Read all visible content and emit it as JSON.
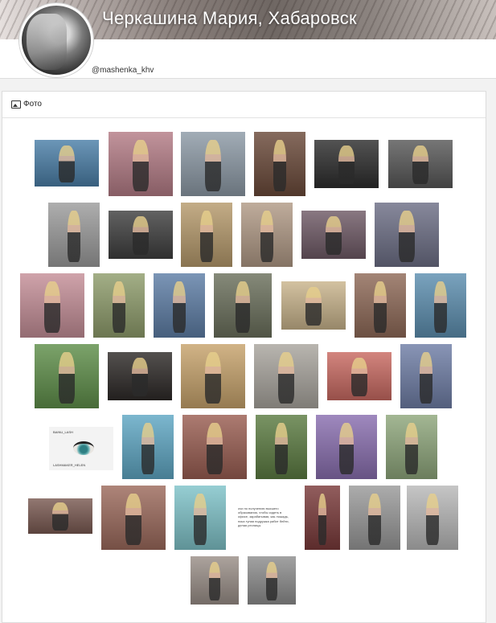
{
  "header": {
    "title": "Черкашина Мария, Хабаровск",
    "username": "@mashenka_khv"
  },
  "photos_section": {
    "label": "Фото",
    "icon": "image-icon"
  },
  "text_card": {
    "text": "очи по получению высшего образования, чтобы сидеть в офисе, зарабатывая, как лошадь, пока тупая подружка рабит бейти, делая ресницы"
  },
  "lash_card": {
    "top_text": "BAINU_LASH",
    "bottom_text": "LASHMAKER_HELEN"
  },
  "photos": [
    {
      "name": "photo-1",
      "color": "#4b7fa8"
    },
    {
      "name": "photo-2",
      "color": "#b47c86"
    },
    {
      "name": "photo-3",
      "color": "#8d9aa6"
    },
    {
      "name": "photo-4",
      "color": "#6b4a3a"
    },
    {
      "name": "photo-5",
      "color": "#2d2d2d"
    },
    {
      "name": "photo-6",
      "color": "#585858"
    },
    {
      "name": "photo-7",
      "color": "#9c9c9c"
    },
    {
      "name": "photo-8",
      "color": "#3f3f3f"
    },
    {
      "name": "photo-9",
      "color": "#b69a6c"
    },
    {
      "name": "photo-10",
      "color": "#b19a86"
    },
    {
      "name": "photo-11",
      "color": "#6f5a66"
    },
    {
      "name": "photo-12",
      "color": "#6d6f86"
    },
    {
      "name": "photo-13",
      "color": "#c58f98"
    },
    {
      "name": "photo-14",
      "color": "#8f9d6c"
    },
    {
      "name": "photo-15",
      "color": "#5e7ea6"
    },
    {
      "name": "photo-16",
      "color": "#6b705c"
    },
    {
      "name": "photo-17",
      "color": "#c9b48c"
    },
    {
      "name": "photo-18",
      "color": "#8f6a58"
    },
    {
      "name": "photo-19",
      "color": "#5d8fb0"
    },
    {
      "name": "photo-20",
      "color": "#5f8f4a"
    },
    {
      "name": "photo-21",
      "color": "#2e2a28"
    },
    {
      "name": "photo-22",
      "color": "#c7a36c"
    },
    {
      "name": "photo-23",
      "color": "#a9a59e"
    },
    {
      "name": "photo-24",
      "color": "#c96a62"
    },
    {
      "name": "photo-25",
      "color": "#6f7ea6"
    },
    {
      "name": "photo-26",
      "color": "#f3f3f3"
    },
    {
      "name": "photo-27",
      "color": "#5fa7c4"
    },
    {
      "name": "photo-28",
      "color": "#9a5e52"
    },
    {
      "name": "photo-29",
      "color": "#5c7c42"
    },
    {
      "name": "photo-30",
      "color": "#8a6fb0"
    },
    {
      "name": "photo-31",
      "color": "#8fa77c"
    },
    {
      "name": "photo-32",
      "color": "#7a5a52"
    },
    {
      "name": "photo-33",
      "color": "#9c6a5c"
    },
    {
      "name": "photo-34",
      "color": "#7fc3c9"
    },
    {
      "name": "photo-35",
      "color": "#ffffff"
    },
    {
      "name": "photo-36",
      "color": "#7a3a3a"
    },
    {
      "name": "photo-37",
      "color": "#9a9a9a"
    },
    {
      "name": "photo-38",
      "color": "#b9b9b9"
    },
    {
      "name": "photo-39",
      "color": "#9a8f88"
    },
    {
      "name": "photo-40",
      "color": "#8e8e8e"
    }
  ]
}
